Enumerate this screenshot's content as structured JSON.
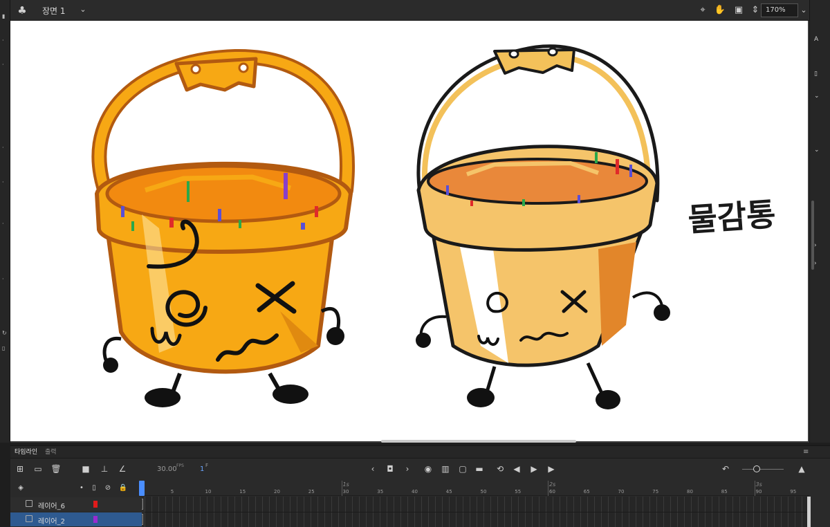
{
  "topbar": {
    "scene_name": "장면 1",
    "zoom": "170%"
  },
  "canvas": {
    "handwritten_label": "물감통"
  },
  "timeline": {
    "tabs": [
      "타임라인",
      "출력"
    ],
    "fps_value": "30.00",
    "fps_label": "FPS",
    "frame_value": "1",
    "frame_label": "F",
    "ruler_numbers": [
      "5",
      "10",
      "15",
      "20",
      "25",
      "30",
      "35",
      "40",
      "45",
      "50",
      "55",
      "60",
      "65",
      "70",
      "75",
      "80",
      "85",
      "90",
      "95"
    ],
    "seconds": [
      "1s",
      "2s",
      "3s"
    ],
    "layers": [
      {
        "name": "레이어_6",
        "color": "#e01b1b"
      },
      {
        "name": "레이어_2",
        "color": "#9a2bd1"
      }
    ]
  },
  "colors": {
    "accent": "#4a8eff",
    "bucket_orange": "#f7a814",
    "bucket_outline": "#b25a10"
  }
}
